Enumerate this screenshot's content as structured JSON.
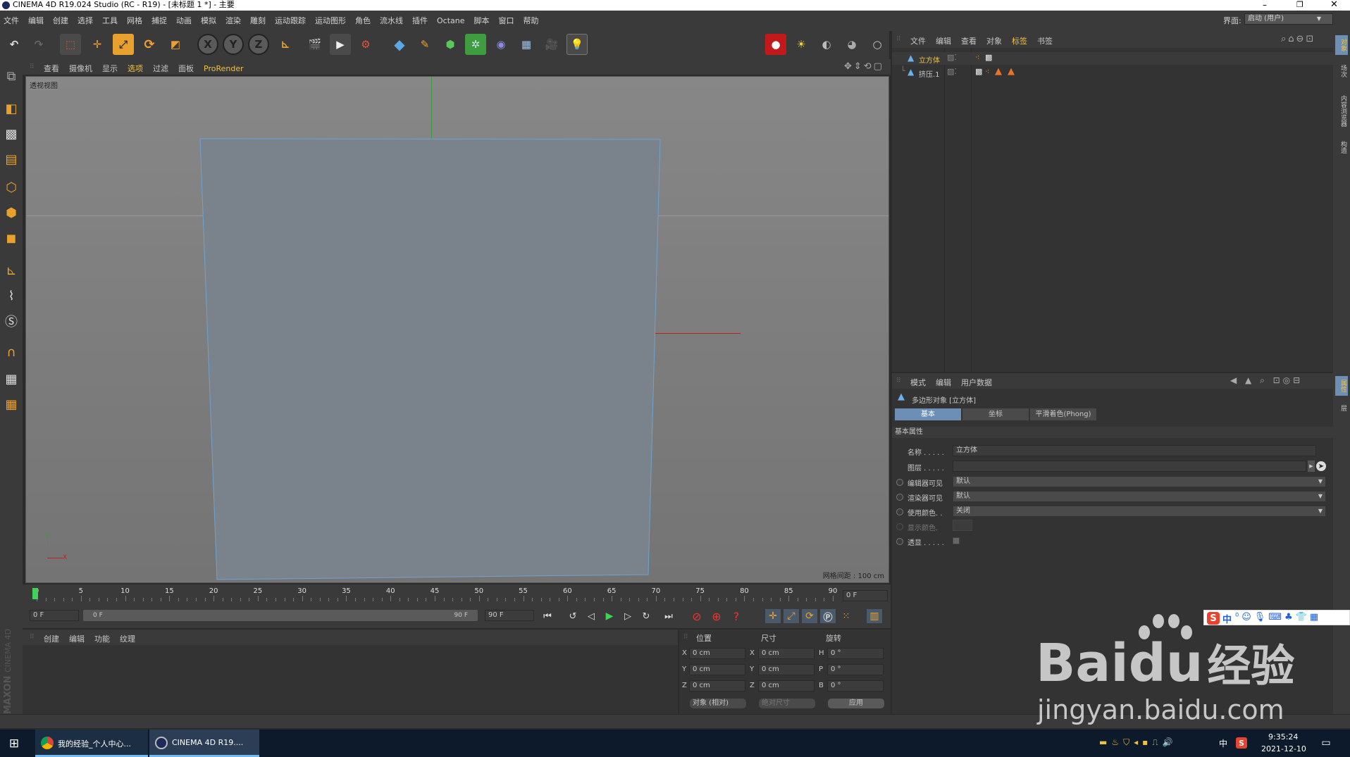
{
  "window": {
    "title": "CINEMA 4D R19.024 Studio (RC - R19) - [未标题 1 *] - 主要"
  },
  "menu": [
    "文件",
    "编辑",
    "创建",
    "选择",
    "工具",
    "网格",
    "捕捉",
    "动画",
    "模拟",
    "渲染",
    "雕刻",
    "运动跟踪",
    "运动图形",
    "角色",
    "流水线",
    "插件",
    "Octane",
    "脚本",
    "窗口",
    "帮助"
  ],
  "layout": {
    "label": "界面:",
    "value": "启动 (用户)"
  },
  "viewport": {
    "menu": [
      "查看",
      "摄像机",
      "显示",
      "选项",
      "过滤",
      "面板",
      "ProRender"
    ],
    "name": "透视视图",
    "grid_spacing": "网格间距 : 100 cm",
    "axis_x": "X",
    "axis_y": "Y"
  },
  "object_manager": {
    "menu": [
      "文件",
      "编辑",
      "查看",
      "对象",
      "标签",
      "书签"
    ],
    "objects": [
      {
        "name": "立方体"
      },
      {
        "name": "挤压.1"
      }
    ]
  },
  "attributes": {
    "menu": [
      "模式",
      "编辑",
      "用户数据"
    ],
    "object_title": "多边形对象 [立方体]",
    "tabs": [
      "基本",
      "坐标",
      "平滑着色(Phong)"
    ],
    "section": "基本属性",
    "fields": {
      "name_label": "名称 . . . . .",
      "name_value": "立方体",
      "layer_label": "图层 . . . . .",
      "editor_label": "编辑器可见",
      "editor_value": "默认",
      "render_label": "渲染器可见",
      "render_value": "默认",
      "color_label": "使用颜色. .",
      "color_value": "关闭",
      "display_label": "显示颜色.",
      "xray_label": "透显 . . . . ."
    }
  },
  "right_tabs": [
    "对象",
    "场次",
    "内容浏览器",
    "构造"
  ],
  "right_tabs2": [
    "属性",
    "层"
  ],
  "timeline": {
    "ticks": [
      "0",
      "5",
      "10",
      "15",
      "20",
      "25",
      "30",
      "35",
      "40",
      "45",
      "50",
      "55",
      "60",
      "65",
      "70",
      "75",
      "80",
      "85",
      "90"
    ],
    "current_frame": "0 F",
    "start": "0 F",
    "range_start": "0 F",
    "range_end": "90 F",
    "end": "90 F"
  },
  "material_panel": {
    "menu": [
      "创建",
      "编辑",
      "功能",
      "纹理"
    ]
  },
  "coords": {
    "headers": [
      "位置",
      "尺寸",
      "旋转"
    ],
    "rows": [
      {
        "a": "X",
        "p": "0 cm",
        "b": "X",
        "s": "0 cm",
        "c": "H",
        "r": "0 °"
      },
      {
        "a": "Y",
        "p": "0 cm",
        "b": "Y",
        "s": "0 cm",
        "c": "P",
        "r": "0 °"
      },
      {
        "a": "Z",
        "p": "0 cm",
        "b": "Z",
        "s": "0 cm",
        "c": "B",
        "r": "0 °"
      }
    ],
    "mode": "对象 (相对)",
    "size_mode": "绝对尺寸",
    "apply": "应用"
  },
  "branding": {
    "maxon": "MAXON",
    "c4d": "CINEMA 4D"
  },
  "watermark": {
    "brand": "Bai",
    "brand2": "du",
    "cn": "经验",
    "url": "jingyan.baidu.com"
  },
  "ime": {
    "cn": "中"
  },
  "taskbar": {
    "items": [
      "我的经验_个人中心...",
      "CINEMA 4D R19...."
    ],
    "ime": "中",
    "time": "9:35:24",
    "date": "2021-12-10"
  }
}
